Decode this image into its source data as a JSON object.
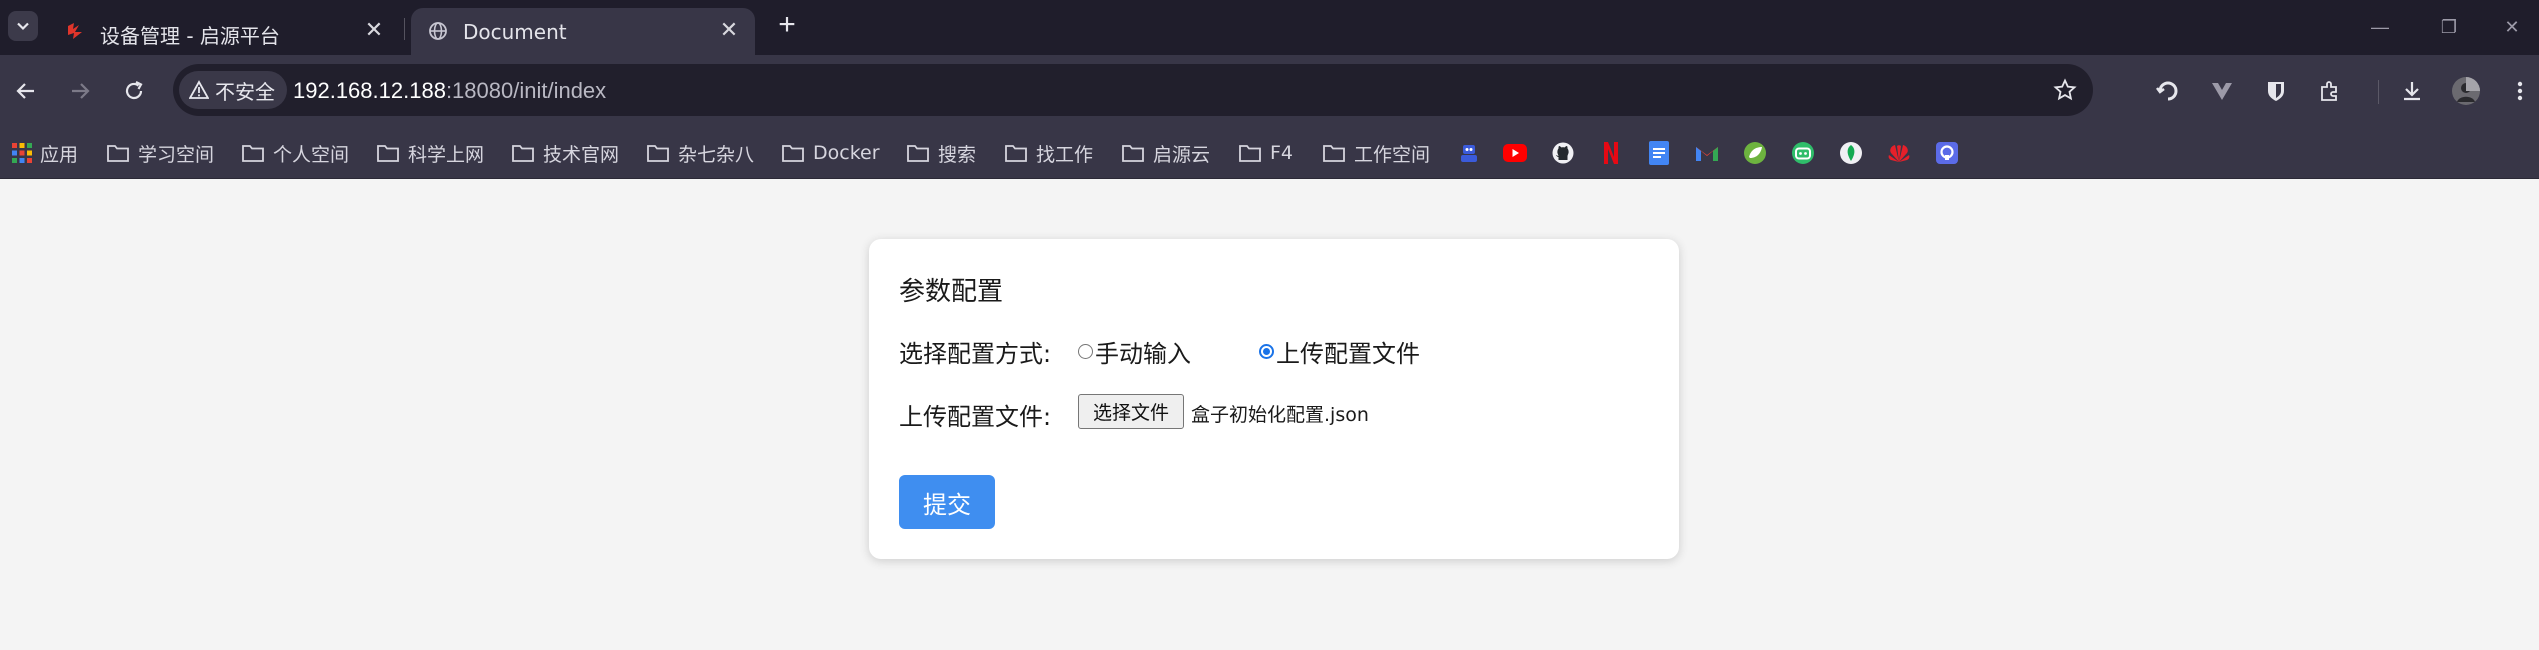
{
  "tabs": [
    {
      "title": "设备管理 - 启源平台",
      "favicon": "qiyuan-logo-icon",
      "active": false
    },
    {
      "title": "Document",
      "favicon": "globe-icon",
      "active": true
    }
  ],
  "toolbar": {
    "security_label": "不安全",
    "url_host": "192.168.12.188",
    "url_rest": ":18080/init/index"
  },
  "bookmarks": [
    {
      "label": "应用",
      "icon": "apps-grid-icon"
    },
    {
      "label": "学习空间",
      "icon": "folder-icon"
    },
    {
      "label": "个人空间",
      "icon": "folder-icon"
    },
    {
      "label": "科学上网",
      "icon": "folder-icon"
    },
    {
      "label": "技术官网",
      "icon": "folder-icon"
    },
    {
      "label": "杂七杂八",
      "icon": "folder-icon"
    },
    {
      "label": "Docker",
      "icon": "folder-icon"
    },
    {
      "label": "搜索",
      "icon": "folder-icon"
    },
    {
      "label": "找工作",
      "icon": "folder-icon"
    },
    {
      "label": "启源云",
      "icon": "folder-icon"
    },
    {
      "label": "F4",
      "icon": "folder-icon"
    },
    {
      "label": "工作空间",
      "icon": "folder-icon"
    }
  ],
  "bookmark_icons": [
    "robot-icon",
    "youtube-icon",
    "github-icon",
    "netflix-icon",
    "docs-icon",
    "gmail-icon",
    "spring-icon",
    "bilibili-icon",
    "leaf-icon",
    "huawei-icon",
    "app-icon"
  ],
  "page": {
    "card_title": "参数配置",
    "mode_label": "选择配置方式:",
    "mode_options": [
      {
        "label": "手动输入",
        "checked": false
      },
      {
        "label": "上传配置文件",
        "checked": true
      }
    ],
    "upload_label": "上传配置文件:",
    "file_button": "选择文件",
    "file_name": "盒子初始化配置.json",
    "submit_label": "提交"
  },
  "colors": {
    "tab_strip_bg": "#1f1d2b",
    "toolbar_bg": "#383647",
    "page_bg": "#f4f4f4",
    "submit_bg": "#3f8ef0",
    "radio_accent": "#1a73e8"
  }
}
